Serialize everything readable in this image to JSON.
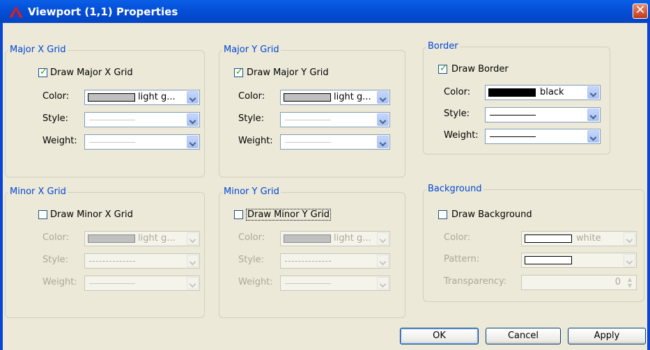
{
  "window": {
    "title": "Viewport (1,1) Properties",
    "title_icon": "triangle-app-icon",
    "close_icon": "close-icon",
    "close_glyph": "✕"
  },
  "major_x": {
    "legend": "Major X Grid",
    "checkbox_label": "Draw Major X Grid",
    "checked": true,
    "color_label": "Color:",
    "color_value": "light g...",
    "style_label": "Style:",
    "weight_label": "Weight:"
  },
  "major_y": {
    "legend": "Major Y Grid",
    "checkbox_label": "Draw Major Y Grid",
    "checked": true,
    "color_label": "Color:",
    "color_value": "light g...",
    "style_label": "Style:",
    "weight_label": "Weight:"
  },
  "border": {
    "legend": "Border",
    "checkbox_label": "Draw Border",
    "checked": true,
    "color_label": "Color:",
    "color_value": "black",
    "style_label": "Style:",
    "weight_label": "Weight:"
  },
  "minor_x": {
    "legend": "Minor X Grid",
    "checkbox_label": "Draw Minor X Grid",
    "checked": false,
    "color_label": "Color:",
    "color_value": "light g...",
    "style_label": "Style:",
    "weight_label": "Weight:"
  },
  "minor_y": {
    "legend": "Minor Y Grid",
    "checkbox_label": "Draw Minor Y Grid",
    "checked": false,
    "color_label": "Color:",
    "color_value": "light g...",
    "style_label": "Style:",
    "weight_label": "Weight:"
  },
  "background": {
    "legend": "Background",
    "checkbox_label": "Draw Background",
    "checked": false,
    "color_label": "Color:",
    "color_value": "white",
    "pattern_label": "Pattern:",
    "transparency_label": "Transparency:",
    "transparency_value": "0"
  },
  "buttons": {
    "ok": "OK",
    "cancel": "Cancel",
    "apply": "Apply"
  },
  "colors": {
    "titlebar": "#0a5fe6",
    "legend": "#0046d5",
    "dialog_bg": "#ece9d8",
    "swatch_light_gray": "#c0c0c0",
    "swatch_black": "#000000",
    "swatch_white": "#ffffff"
  }
}
